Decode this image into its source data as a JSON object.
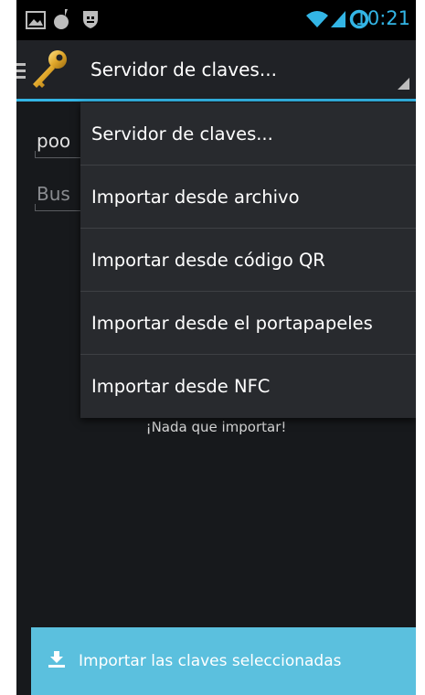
{
  "status_bar": {
    "time": "10:21",
    "icons": [
      "image-icon",
      "hand-icon",
      "shield-icon",
      "wifi-icon",
      "signal-icon",
      "battery-ring-icon"
    ],
    "accent": "#33b5e5"
  },
  "action_bar": {
    "spinner_label": "Servidor de claves...",
    "icons": [
      "drawer-icon",
      "key-icon",
      "spinner-arrow-icon"
    ]
  },
  "background_content": {
    "field1_text": "poo",
    "field2_placeholder": "Bus",
    "empty_message": "¡Nada que importar!"
  },
  "dropdown": {
    "items": [
      {
        "label": "Servidor de claves..."
      },
      {
        "label": "Importar desde archivo"
      },
      {
        "label": "Importar desde código QR"
      },
      {
        "label": "Importar desde el portapapeles"
      },
      {
        "label": "Importar desde NFC"
      }
    ]
  },
  "footer": {
    "import_button_label": "Importar las claves seleccionadas",
    "icon": "download-icon",
    "color": "#5bc0de"
  }
}
